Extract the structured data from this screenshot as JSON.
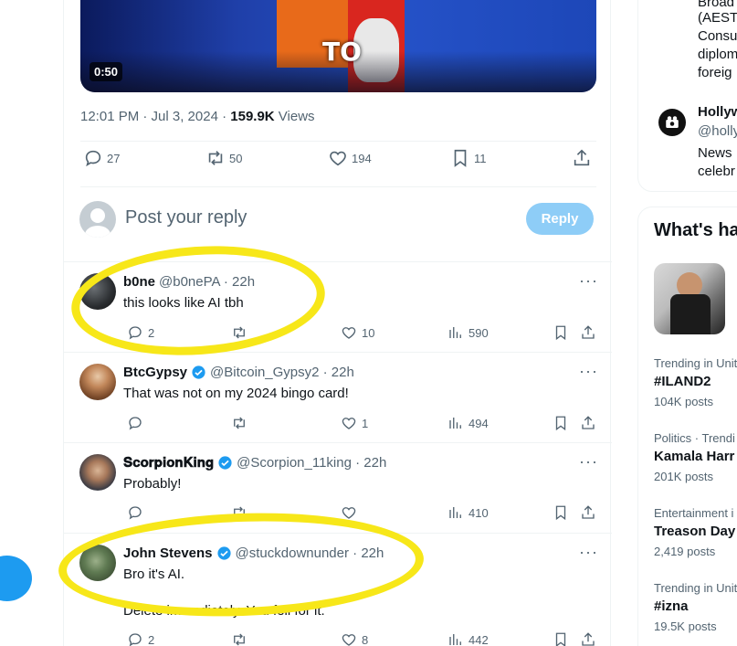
{
  "post": {
    "video_duration": "0:50",
    "video_text": "TO",
    "timestamp": "12:01 PM · Jul 3, 2024 · ",
    "views_count": "159.9K",
    "views_label": " Views",
    "stats": {
      "replies": "27",
      "reposts": "50",
      "likes": "194",
      "bookmarks": "11"
    }
  },
  "reply_box": {
    "placeholder": "Post your reply",
    "button_label": "Reply"
  },
  "replies": [
    {
      "name": "b0ne",
      "handle": "@b0nePA · 22h",
      "verified": false,
      "text": "this looks like AI tbh",
      "replies": "2",
      "reposts": "",
      "likes": "10",
      "views": "590"
    },
    {
      "name": "BtcGypsy",
      "handle": "@Bitcoin_Gypsy2 · 22h",
      "verified": true,
      "text": "That was not on my 2024 bingo card!",
      "replies": "",
      "reposts": "",
      "likes": "1",
      "views": "494"
    },
    {
      "name": "𝐒𝐜𝐨𝐫𝐩𝐢𝐨𝐧𝐊𝐢𝐧𝐠",
      "handle": "@Scorpion_11king · 22h",
      "verified": true,
      "text": "Probably!",
      "replies": "",
      "reposts": "",
      "likes": "",
      "views": "410"
    },
    {
      "name": "John Stevens",
      "handle": "@stuckdownunder · 22h",
      "verified": true,
      "text_line1": "Bro it's AI.",
      "text_line2": "Delete immediately. You fell for it.",
      "replies": "2",
      "reposts": "",
      "likes": "8",
      "views": "442"
    }
  ],
  "sidebar": {
    "card1": {
      "lines": [
        "Broad",
        "(AEST",
        "Consu",
        "diplom",
        "foreig"
      ],
      "account_name": "Hollyw",
      "account_handle": "@holly",
      "bio_line1": "News",
      "bio_line2": "celebr"
    },
    "whats_happening": {
      "title": "What's ha",
      "trends": [
        {
          "context": "Trending in Unit",
          "name": "#ILAND2",
          "count": "104K posts"
        },
        {
          "context": "Politics · Trendi",
          "name": "Kamala Harr",
          "count": "201K posts"
        },
        {
          "context": "Entertainment i",
          "name": "Treason Day",
          "count": "2,419 posts"
        },
        {
          "context": "Trending in Unit",
          "name": "#izna",
          "count": "19.5K posts"
        }
      ]
    }
  },
  "colors": {
    "accent": "#1d9bf0",
    "highlight": "#f7e719",
    "muted": "#536471"
  }
}
